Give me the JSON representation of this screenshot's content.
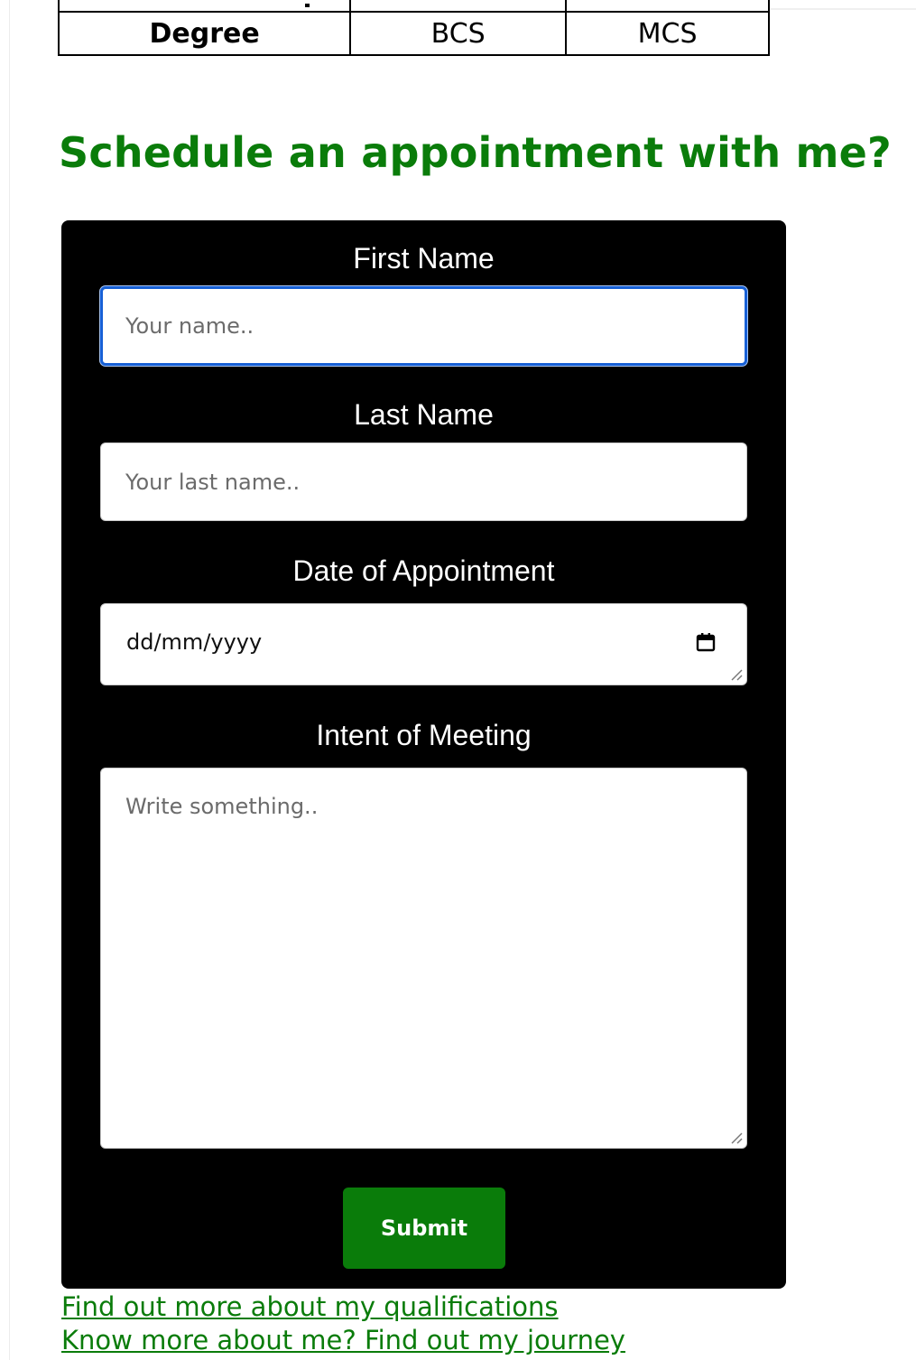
{
  "qualifications_table": {
    "row": {
      "header": "Degree",
      "values": [
        "BCS",
        "MCS"
      ]
    }
  },
  "heading": "Schedule an appointment with me?",
  "form": {
    "first_name": {
      "label": "First Name",
      "placeholder": "Your name.."
    },
    "last_name": {
      "label": "Last Name",
      "placeholder": "Your last name.."
    },
    "date": {
      "label": "Date of Appointment",
      "value": "dd/mm/yyyy"
    },
    "intent": {
      "label": "Intent of Meeting",
      "placeholder": "Write something.."
    },
    "submit_label": "Submit"
  },
  "links": {
    "qualifications": "Find out more about my qualifications",
    "journey": "Know more about me? Find out my journey"
  },
  "colors": {
    "brand_green": "#0a7c0a",
    "panel_background": "#000000",
    "focus_border": "#1760d6"
  },
  "icons": {
    "date_picker": "calendar-icon",
    "resize": "resize-grip-icon"
  }
}
